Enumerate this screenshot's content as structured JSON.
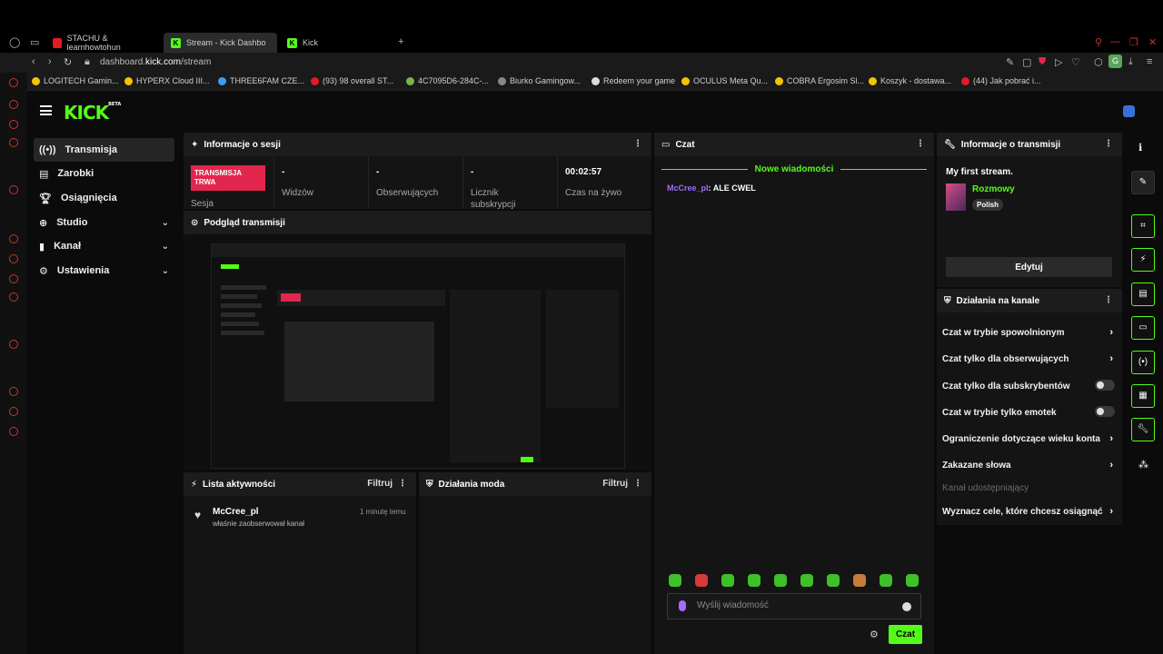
{
  "browser": {
    "tabs": [
      {
        "label": "STACHU & learnhowtohun",
        "icon": "youtube-icon"
      },
      {
        "label": "Stream - Kick Dashbo",
        "icon": "kick-icon"
      },
      {
        "label": "Kick",
        "icon": "kick-icon"
      }
    ],
    "url_prefix": "dashboard.",
    "url_domain": "kick.com",
    "url_path": "/stream",
    "bookmarks": [
      "LOGITECH Gamin...",
      "HYPERX Cloud III...",
      "THREE6FAM CZE...",
      "(93) 98 overall ST...",
      "4C7095D6-284C-...",
      "Biurko Gamingow...",
      "Redeem your game",
      "OCULUS Meta Qu...",
      "COBRA Ergosim Sl...",
      "Koszyk - dostawa...",
      "(44) Jak pobrać i..."
    ],
    "profile_initial": "G"
  },
  "logo": {
    "text": "KICK",
    "badge": "BETA"
  },
  "sidebar": {
    "items": [
      {
        "label": "Transmisja",
        "icon": "broadcast-icon",
        "active": true,
        "expandable": false
      },
      {
        "label": "Zarobki",
        "icon": "earnings-icon",
        "active": false,
        "expandable": false
      },
      {
        "label": "Osiągnięcia",
        "icon": "trophy-icon",
        "active": false,
        "expandable": false
      },
      {
        "label": "Studio",
        "icon": "studio-icon",
        "active": false,
        "expandable": true
      },
      {
        "label": "Kanał",
        "icon": "channel-icon",
        "active": false,
        "expandable": true
      },
      {
        "label": "Ustawienia",
        "icon": "settings-icon",
        "active": false,
        "expandable": true
      }
    ]
  },
  "session": {
    "title": "Informacje o sesji",
    "live_badge": "TRANSMISJA TRWA",
    "session_label": "Sesja",
    "stats": [
      {
        "value": "-",
        "label": "Widzów"
      },
      {
        "value": "-",
        "label": "Obserwujących"
      },
      {
        "value": "-",
        "label": "Licznik subskrypcji"
      },
      {
        "value": "00:02:57",
        "label": "Czas na żywo"
      }
    ]
  },
  "preview": {
    "title": "Podgląd transmisji"
  },
  "activity": {
    "title": "Lista aktywności",
    "filter": "Filtruj",
    "items": [
      {
        "name": "McCree_pl",
        "desc": "właśnie zaobserwował kanał",
        "time": "1 minutę temu"
      }
    ]
  },
  "mod": {
    "title": "Działania moda",
    "filter": "Filtruj"
  },
  "chat": {
    "title": "Czat",
    "new_messages": "Nowe wiadomości",
    "messages": [
      {
        "user": "McCree_pl",
        "text": ": ALE CWEL"
      }
    ],
    "placeholder": "Wyślij wiadomość",
    "send": "Czat"
  },
  "stream_info": {
    "title": "Informacje o transmisji",
    "stream_title": "My first stream.",
    "category": "Rozmowy",
    "tag": "Polish",
    "edit": "Edytuj"
  },
  "channel_actions": {
    "title": "Działania na kanale",
    "items": [
      {
        "label": "Czat w trybie spowolnionym",
        "control": "chevron"
      },
      {
        "label": "Czat tylko dla obserwujących",
        "control": "chevron"
      },
      {
        "label": "Czat tylko dla subskrybentów",
        "control": "toggle"
      },
      {
        "label": "Czat w trybie tylko emotek",
        "control": "toggle"
      },
      {
        "label": "Ograniczenie dotyczące wieku konta",
        "control": "chevron"
      },
      {
        "label": "Zakazane słowa",
        "control": "chevron"
      }
    ],
    "shared_label": "Kanał udostępniający",
    "goals": "Wyznacz cele, które chcesz osiągnąć"
  },
  "colors": {
    "accent": "#53fc18",
    "live": "#e2264d",
    "username": "#a56cff"
  }
}
